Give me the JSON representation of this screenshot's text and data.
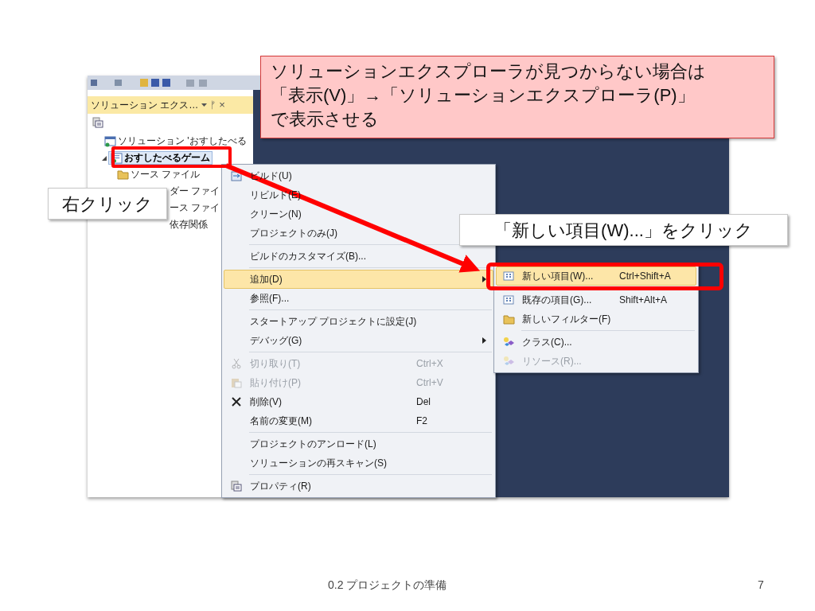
{
  "note": {
    "lines": [
      "ソリューションエクスプローラが見つからない場合は",
      "「表示(V)」→「ソリューションエクスプローラ(P)」",
      "で表示させる"
    ]
  },
  "callouts": [
    {
      "text": "右クリック",
      "kind": "left"
    },
    {
      "text": "「新しい項目(W)...」をクリック",
      "kind": "right"
    }
  ],
  "solution_explorer": {
    "title": "ソリューション エクス…",
    "pin": "ᚠ",
    "close": "×",
    "tree": [
      {
        "label": "ソリューション 'おすしたべる",
        "kind": "solution",
        "selected": false,
        "children": [
          {
            "label": "おすしたべるゲーム",
            "kind": "project",
            "selected": true,
            "expanded": true,
            "children": [
              {
                "label": "ソース ファイル",
                "kind": "folder",
                "selected": false
              },
              {
                "label": "ダー ファイ",
                "kind": "partial",
                "selected": false
              },
              {
                "label": "ース ファイ",
                "kind": "partial",
                "selected": false
              },
              {
                "label": "依存関係",
                "kind": "partial",
                "selected": false
              }
            ]
          }
        ]
      }
    ]
  },
  "context_menu": [
    {
      "kind": "build",
      "label": "ビルド(U)",
      "disabled": false,
      "selected": false
    },
    {
      "kind": "plain",
      "label": "リビルド(E)",
      "disabled": false,
      "selected": false
    },
    {
      "kind": "plain",
      "label": "クリーン(N)",
      "disabled": false,
      "selected": false
    },
    {
      "kind": "plain",
      "label": "プロジェクトのみ(J)",
      "disabled": false,
      "selected": false
    },
    {
      "kind": "separator"
    },
    {
      "kind": "plain",
      "label": "ビルドのカスタマイズ(B)...",
      "disabled": false,
      "selected": false
    },
    {
      "kind": "separator"
    },
    {
      "kind": "plain",
      "label": "追加(D)",
      "submenu": true,
      "disabled": false,
      "selected": true
    },
    {
      "kind": "plain",
      "label": "参照(F)...",
      "disabled": false,
      "selected": false
    },
    {
      "kind": "separator"
    },
    {
      "kind": "plain",
      "label": "スタートアップ プロジェクトに設定(J)",
      "disabled": false,
      "selected": false
    },
    {
      "kind": "plain",
      "label": "デバッグ(G)",
      "submenu": true,
      "disabled": false,
      "selected": false
    },
    {
      "kind": "separator"
    },
    {
      "kind": "cut",
      "label": "切り取り(T)",
      "shortcut": "Ctrl+X",
      "disabled": true,
      "selected": false
    },
    {
      "kind": "paste",
      "label": "貼り付け(P)",
      "shortcut": "Ctrl+V",
      "disabled": true,
      "selected": false
    },
    {
      "kind": "delete",
      "label": "削除(V)",
      "shortcut": "Del",
      "disabled": false,
      "selected": false
    },
    {
      "kind": "plain",
      "label": "名前の変更(M)",
      "shortcut": "F2",
      "disabled": false,
      "selected": false
    },
    {
      "kind": "separator"
    },
    {
      "kind": "plain",
      "label": "プロジェクトのアンロード(L)",
      "disabled": false,
      "selected": false
    },
    {
      "kind": "plain",
      "label": "ソリューションの再スキャン(S)",
      "disabled": false,
      "selected": false
    },
    {
      "kind": "separator"
    },
    {
      "kind": "properties",
      "label": "プロパティ(R)",
      "disabled": false,
      "selected": false
    }
  ],
  "submenu": [
    {
      "kind": "grid",
      "label": "新しい項目(W)...",
      "shortcut": "Ctrl+Shift+A",
      "disabled": false,
      "selected": true
    },
    {
      "kind": "grid",
      "label": "既存の項目(G)...",
      "shortcut": "Shift+Alt+A",
      "disabled": false,
      "selected": false
    },
    {
      "kind": "folder",
      "label": "新しいフィルター(F)",
      "disabled": false,
      "selected": false
    },
    {
      "kind": "separator"
    },
    {
      "kind": "class",
      "label": "クラス(C)...",
      "disabled": false,
      "selected": false
    },
    {
      "kind": "class",
      "label": "リソース(R)...",
      "disabled": true,
      "selected": false
    }
  ],
  "footer": {
    "section": "0.2 プロジェクトの準備",
    "page": "7"
  }
}
